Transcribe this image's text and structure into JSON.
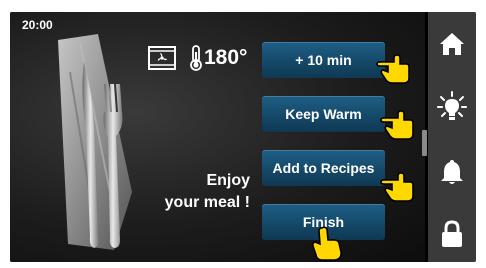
{
  "status_bar": {
    "time": "20:00"
  },
  "oven_status": {
    "mode_icon": "fan-mode-icon",
    "temperature": "180°"
  },
  "message": {
    "line1": "Enjoy",
    "line2": "your meal !"
  },
  "actions": {
    "add_10_min": "+ 10 min",
    "keep_warm": "Keep Warm",
    "add_to_recipes": "Add to Recipes",
    "finish": "Finish"
  },
  "sidebar": {
    "items": [
      "home-icon",
      "light-icon",
      "bell-icon",
      "lock-icon"
    ]
  },
  "colors": {
    "button_blue": "#1a5479",
    "sidebar_gray": "#3a3a3a",
    "pointer_yellow": "#ffd800"
  }
}
